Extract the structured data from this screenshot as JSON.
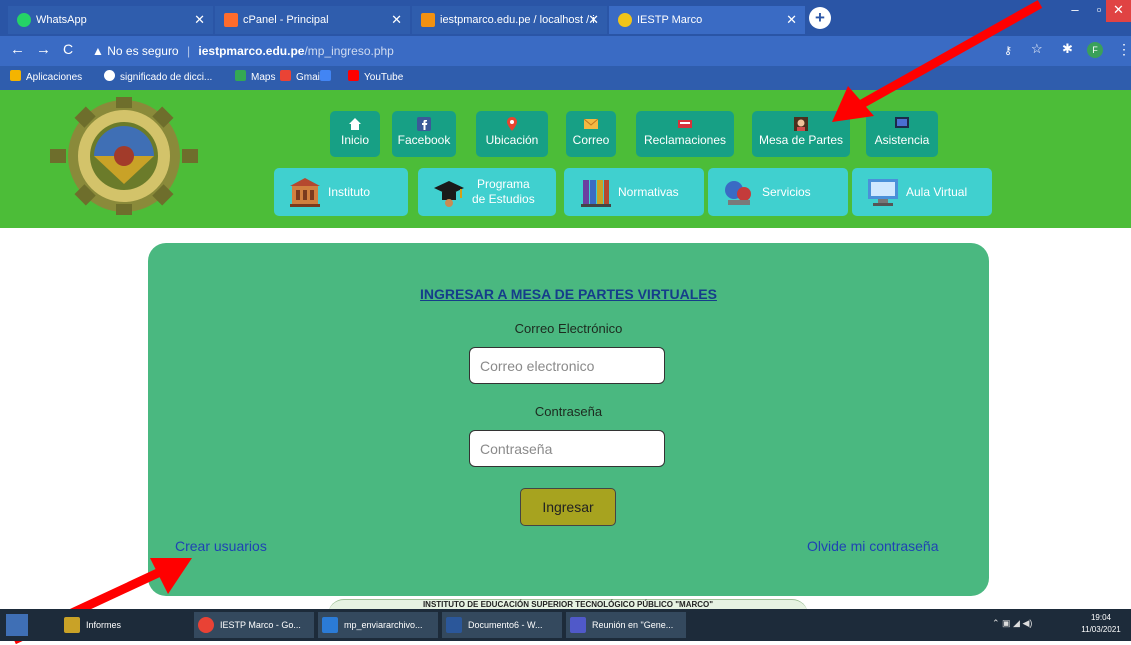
{
  "browser": {
    "tabs": [
      {
        "title": "WhatsApp",
        "color": "#25d366"
      },
      {
        "title": "cPanel - Principal",
        "color": "#ff6c2c"
      },
      {
        "title": "iestpmarco.edu.pe / localhost / i",
        "color": "#f29111"
      },
      {
        "title": "IESTP Marco",
        "color": "#f0c419"
      }
    ],
    "security_label": "No es seguro",
    "url_host": "iestpmarco.edu.pe",
    "url_path": "/mp_ingreso.php",
    "bookmarks": [
      {
        "label": "Aplicaciones",
        "color": "#f4b400"
      },
      {
        "label": "significado de dicci...",
        "color": "#ffffff"
      },
      {
        "label": "Maps",
        "color": "#34a853"
      },
      {
        "label": "Gmail",
        "color": "#ea4335"
      },
      {
        "label": "",
        "color": "#4285f4"
      },
      {
        "label": "YouTube",
        "color": "#ff0000"
      }
    ]
  },
  "site": {
    "nav_top": [
      {
        "label": "Inicio",
        "icon": "home-icon"
      },
      {
        "label": "Facebook",
        "icon": "facebook-icon"
      },
      {
        "label": "Ubicación",
        "icon": "location-pin-icon"
      },
      {
        "label": "Correo",
        "icon": "mail-icon"
      },
      {
        "label": "Reclamaciones",
        "icon": "complaint-book-icon"
      },
      {
        "label": "Mesa de Partes",
        "icon": "receptionist-icon"
      },
      {
        "label": "Asistencia",
        "icon": "attendance-screen-icon"
      }
    ],
    "nav_sections": [
      {
        "label": "Instituto",
        "icon": "building-icon"
      },
      {
        "label": "Programa de Estudios",
        "line1": "Programa",
        "line2": "de Estudios",
        "icon": "graduation-cap-icon"
      },
      {
        "label": "Normativas",
        "icon": "law-books-icon"
      },
      {
        "label": "Servicios",
        "icon": "services-icon"
      },
      {
        "label": "Aula Virtual",
        "icon": "virtual-classroom-icon"
      }
    ],
    "colors": {
      "header": "#4cbd38",
      "card": "#4ab880",
      "top_button": "#17a085",
      "section_button": "#40d0cf"
    }
  },
  "login": {
    "title": "INGRESAR A MESA DE PARTES VIRTUALES",
    "email_label": "Correo Electrónico",
    "email_placeholder": "Correo electronico",
    "password_label": "Contraseña",
    "password_placeholder": "Contraseña",
    "submit": "Ingresar",
    "create_users": "Crear usuarios",
    "forgot_password": "Olvide mi contraseña"
  },
  "footer_text": "INSTITUTO DE EDUCACIÓN SUPERIOR TECNOLÓGICO PÚBLICO \"MARCO\"",
  "taskbar": {
    "items": [
      {
        "label": "Informes",
        "color": "#c9a227"
      },
      {
        "label": "IESTP Marco - Go...",
        "color": "#e94235"
      },
      {
        "label": "mp_enviararchivo...",
        "color": "#2b7bd6"
      },
      {
        "label": "Documento6 - W...",
        "color": "#2b579a"
      },
      {
        "label": "Reunión en \"Gene...",
        "color": "#5059c9"
      }
    ],
    "time": "19:04",
    "date": "11/03/2021"
  },
  "annotations": {
    "arrow_color": "#ff0000"
  }
}
